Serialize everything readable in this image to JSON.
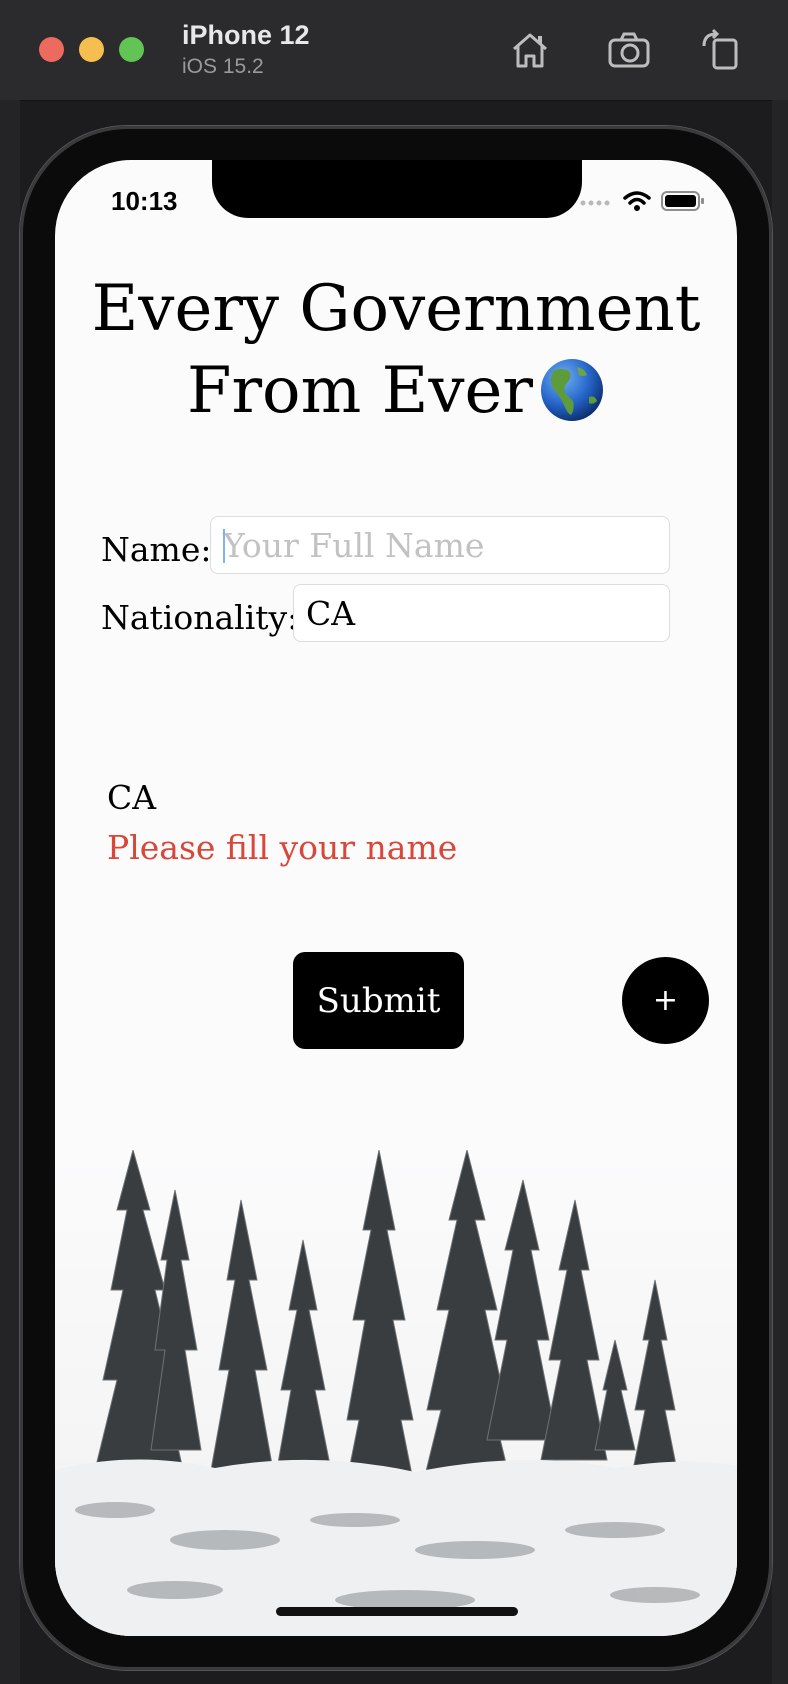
{
  "simulator": {
    "device_name": "iPhone 12",
    "os_version": "iOS 15.2",
    "toolbar_icons": [
      "home-icon",
      "screenshot-camera-icon",
      "rotate-icon"
    ]
  },
  "status_bar": {
    "time": "10:13",
    "icons": [
      "signal-icon",
      "wifi-icon",
      "battery-icon"
    ]
  },
  "app": {
    "title_line1": "Every Government",
    "title_line2": "From Ever",
    "title_icon": "globe-americas-icon",
    "form": {
      "name_label": "Name:",
      "name_value": "",
      "name_placeholder": "Your Full Name",
      "nationality_label": "Nationality:",
      "nationality_value": "CA"
    },
    "echo_text": "CA",
    "error_text": "Please fill your name",
    "submit_label": "Submit",
    "fab_label": "+",
    "background_image": "snowy-pine-forest"
  },
  "colors": {
    "error": "#d9463a",
    "button": "#000000",
    "screen_bg": "#fbfbfc"
  }
}
